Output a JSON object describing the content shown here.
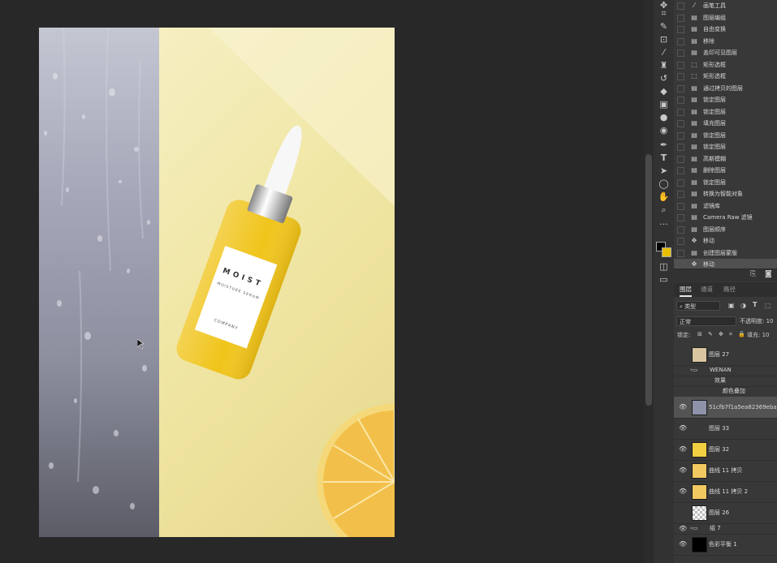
{
  "document": {
    "bottle_label": {
      "title": "MOIST",
      "subtitle": "MOISTURE SERUM",
      "company": "COMPANY"
    }
  },
  "toolbar": {
    "tools": [
      "move-icon",
      "crop-icon",
      "eyedropper-icon",
      "patch-icon",
      "brush-icon",
      "stamp-icon",
      "history-brush-icon",
      "eraser-icon",
      "gradient-icon",
      "blur-icon",
      "dodge-icon",
      "pen-icon",
      "type-icon",
      "path-select-icon",
      "ellipse-icon",
      "hand-icon",
      "zoom-icon",
      "more-icon"
    ]
  },
  "history": {
    "items": [
      {
        "label": "画笔工具",
        "icon": "brush-icon",
        "active": false
      },
      {
        "label": "图层编组",
        "icon": "doc-icon",
        "active": false
      },
      {
        "label": "自由变换",
        "icon": "doc-icon",
        "active": false
      },
      {
        "label": "移除",
        "icon": "doc-icon",
        "active": false
      },
      {
        "label": "盖印可见图层",
        "icon": "doc-icon",
        "active": false
      },
      {
        "label": "矩形选框",
        "icon": "marquee-icon",
        "active": false
      },
      {
        "label": "矩形选框",
        "icon": "marquee-icon",
        "active": false
      },
      {
        "label": "通过拷贝的图层",
        "icon": "doc-icon",
        "active": false
      },
      {
        "label": "锁定图层",
        "icon": "doc-icon",
        "active": false
      },
      {
        "label": "锁定图层",
        "icon": "doc-icon",
        "active": false
      },
      {
        "label": "填充图层",
        "icon": "doc-icon",
        "active": false
      },
      {
        "label": "锁定图层",
        "icon": "doc-icon",
        "active": false
      },
      {
        "label": "锁定图层",
        "icon": "doc-icon",
        "active": false
      },
      {
        "label": "高斯模糊",
        "icon": "doc-icon",
        "active": false
      },
      {
        "label": "删除图层",
        "icon": "doc-icon",
        "active": false
      },
      {
        "label": "锁定图层",
        "icon": "doc-icon",
        "active": false
      },
      {
        "label": "转换为智能对象",
        "icon": "doc-icon",
        "active": false
      },
      {
        "label": "滤镜库",
        "icon": "doc-icon",
        "active": false
      },
      {
        "label": "Camera Raw 滤镜",
        "icon": "doc-icon",
        "active": false
      },
      {
        "label": "图层顺序",
        "icon": "doc-icon",
        "active": false
      },
      {
        "label": "移动",
        "icon": "move-icon",
        "active": false
      },
      {
        "label": "创建图层蒙版",
        "icon": "doc-icon",
        "active": false
      },
      {
        "label": "移动",
        "icon": "move-icon",
        "active": true
      }
    ]
  },
  "layers_panel": {
    "tabs": [
      "图层",
      "通道",
      "路径"
    ],
    "filter_label": "类型",
    "blend_mode": "正常",
    "opacity_label": "不透明度: 10",
    "lock_label": "锁定:",
    "fill_label": "填充: 10",
    "layers": [
      {
        "name": "图层 27",
        "visible": false,
        "thumb": "#d9c6a0",
        "selected": false,
        "kind": "layer"
      },
      {
        "name": "WENAN",
        "visible": false,
        "thumb": "",
        "selected": false,
        "kind": "group"
      },
      {
        "name": "效果",
        "visible": false,
        "thumb": "",
        "selected": false,
        "kind": "effects"
      },
      {
        "name": "颜色叠加",
        "visible": false,
        "thumb": "",
        "selected": false,
        "kind": "effect"
      },
      {
        "name": "51cfb7f1a5ea82369eba6",
        "visible": true,
        "thumb": "#8e93aa",
        "selected": true,
        "kind": "smart"
      },
      {
        "name": "图层 33",
        "visible": true,
        "thumb": "",
        "selected": false,
        "kind": "layer"
      },
      {
        "name": "图层 32",
        "visible": true,
        "thumb": "#f0d040",
        "selected": false,
        "kind": "layer"
      },
      {
        "name": "曲线 11 拷贝",
        "visible": true,
        "thumb": "#f2c860",
        "selected": false,
        "kind": "layer"
      },
      {
        "name": "曲线 11 拷贝 2",
        "visible": true,
        "thumb": "#f2c860",
        "selected": false,
        "kind": "layer"
      },
      {
        "name": "图层 26",
        "visible": false,
        "thumb": "checker",
        "selected": false,
        "kind": "layer"
      },
      {
        "name": "组 7",
        "visible": true,
        "thumb": "",
        "selected": false,
        "kind": "group"
      },
      {
        "name": "色彩平衡 1",
        "visible": true,
        "thumb": "#000000",
        "selected": false,
        "kind": "adjustment"
      }
    ]
  }
}
